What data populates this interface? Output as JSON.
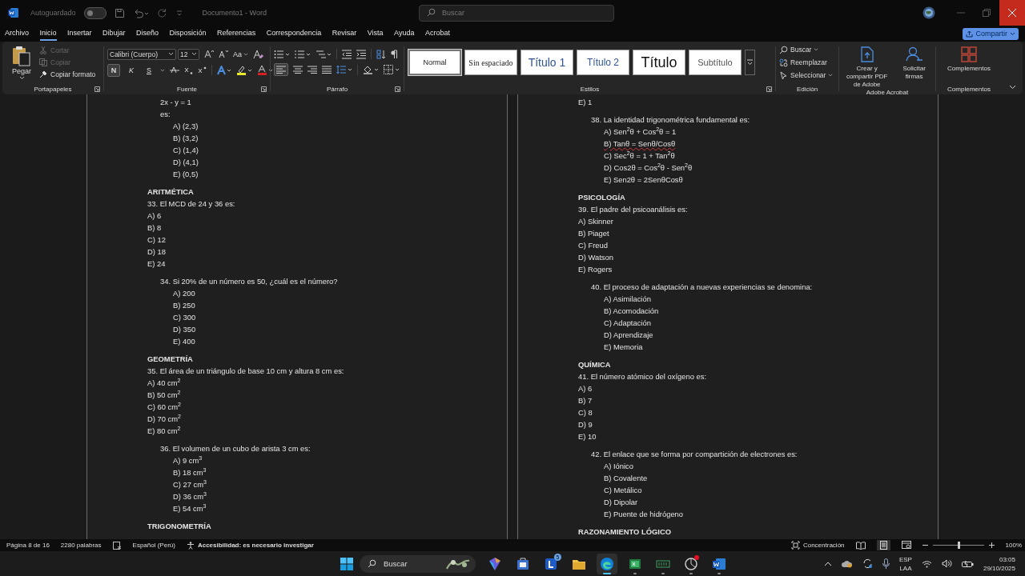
{
  "title_bar": {
    "autosave_label": "Autoguardado",
    "autosave_on": false,
    "document_title": "Documento1 - Word",
    "search_placeholder": "Buscar"
  },
  "menu_tabs": [
    {
      "label": "Archivo",
      "selected": false
    },
    {
      "label": "Inicio",
      "selected": true
    },
    {
      "label": "Insertar",
      "selected": false
    },
    {
      "label": "Dibujar",
      "selected": false
    },
    {
      "label": "Diseño",
      "selected": false
    },
    {
      "label": "Disposición",
      "selected": false
    },
    {
      "label": "Referencias",
      "selected": false
    },
    {
      "label": "Correspondencia",
      "selected": false
    },
    {
      "label": "Revisar",
      "selected": false
    },
    {
      "label": "Vista",
      "selected": false
    },
    {
      "label": "Ayuda",
      "selected": false
    },
    {
      "label": "Acrobat",
      "selected": false
    }
  ],
  "share_button": "Compartir",
  "ribbon": {
    "clipboard": {
      "label": "Portapapeles",
      "paste": "Pegar",
      "actions": [
        {
          "label": "Cortar",
          "disabled": true
        },
        {
          "label": "Copiar",
          "disabled": true
        },
        {
          "label": "Copiar formato",
          "disabled": false
        }
      ]
    },
    "font": {
      "label": "Fuente",
      "font_name": "Calibri (Cuerpo)",
      "font_size": "12",
      "case_button": "Aa",
      "format_buttons": [
        {
          "label": "N",
          "selected": true
        },
        {
          "label": "K",
          "selected": false
        },
        {
          "label": "S",
          "selected": false
        }
      ]
    },
    "paragraph": {
      "label": "Párrafo"
    },
    "styles": {
      "label": "Estilos",
      "items": [
        {
          "label": "Normal",
          "kind": "normal",
          "selected": true
        },
        {
          "label": "Sin espaciado",
          "kind": "nospacing",
          "selected": false
        },
        {
          "label": "Título 1",
          "kind": "heading1",
          "selected": false
        },
        {
          "label": "Título 2",
          "kind": "heading2",
          "selected": false
        },
        {
          "label": "Título",
          "kind": "title",
          "selected": false
        },
        {
          "label": "Subtítulo",
          "kind": "subtitle",
          "selected": false
        }
      ]
    },
    "editing": {
      "label": "Edición",
      "actions": [
        "Buscar",
        "Reemplazar",
        "Seleccionar"
      ]
    },
    "acrobat": {
      "label": "Adobe Acrobat",
      "actions": [
        "Crear y compartir PDF de Adobe",
        "Solicitar firmas"
      ]
    },
    "addins": {
      "label": "Complementos",
      "button": "Complementos"
    }
  },
  "document": {
    "pages": [
      {
        "blocks": [
          {
            "kind": "question",
            "indented": true,
            "lines": [
              "2x - y = 1",
              "es:"
            ],
            "options": [
              "A) (2,3)",
              "B) (3,2)",
              "C) (1,4)",
              "D) (4,1)",
              "E) (0,5)"
            ]
          },
          {
            "kind": "heading",
            "text": "ARITMÉTICA"
          },
          {
            "kind": "question",
            "indented": false,
            "lines": [
              "33. El MCD de 24 y 36 es:"
            ],
            "options": [
              "A) 6",
              "B) 8",
              "C) 12",
              "D) 18",
              "E) 24"
            ]
          },
          {
            "kind": "question",
            "indented": true,
            "lines": [
              "34. Si 20% de un número es 50, ¿cuál es el número?"
            ],
            "options": [
              "A) 200",
              "B) 250",
              "C) 300",
              "D) 350",
              "E) 400"
            ]
          },
          {
            "kind": "heading",
            "text": "GEOMETRÍA"
          },
          {
            "kind": "question",
            "indented": false,
            "lines": [
              "35. El área de un triángulo de base 10 cm y altura 8 cm es:"
            ],
            "options": [
              "A) 40 cm$^{2}$",
              "B) 50 cm$^{2}$",
              "C) 60 cm$^{2}$",
              "D) 70 cm$^{2}$",
              "E) 80 cm$^{2}$"
            ]
          },
          {
            "kind": "question",
            "indented": true,
            "lines": [
              "36. El volumen de un cubo de arista 3 cm es:"
            ],
            "options": [
              "A) 9 cm$^{3}$",
              "B) 18 cm$^{3}$",
              "C) 27 cm$^{3}$",
              "D) 36 cm$^{3}$",
              "E) 54 cm$^{3}$"
            ]
          },
          {
            "kind": "heading",
            "text": "TRIGONOMETRÍA"
          }
        ]
      },
      {
        "blocks": [
          {
            "kind": "question",
            "indented": false,
            "options": [
              "E) 1"
            ]
          },
          {
            "kind": "question",
            "indented": true,
            "lines": [
              "38. La identidad trigonométrica fundamental es:"
            ],
            "options": [
              "A) Sen$^{2}$θ + Cos$^{2}$θ = 1",
              {
                "text": "B) Tanθ = Senθ/Cosθ",
                "misspelled": true
              },
              "C) Sec$^{2}$θ = 1 + Tan$^{2}$θ",
              "D) Cos2θ = Cos$^{2}$θ - Sen$^{2}$θ",
              "E) Sen2θ = 2SenθCosθ"
            ]
          },
          {
            "kind": "heading",
            "text": "PSICOLOGÍA"
          },
          {
            "kind": "question",
            "indented": false,
            "lines": [
              "39. El padre del psicoanálisis es:"
            ],
            "options": [
              "A) Skinner",
              "B) Piaget",
              "C) Freud",
              "D) Watson",
              "E) Rogers"
            ]
          },
          {
            "kind": "question",
            "indented": true,
            "lines": [
              "40. El proceso de adaptación a nuevas experiencias se denomina:"
            ],
            "options": [
              "A) Asimilación",
              "B) Acomodación",
              "C) Adaptación",
              "D) Aprendizaje",
              "E) Memoria"
            ]
          },
          {
            "kind": "heading",
            "text": "QUÍMICA"
          },
          {
            "kind": "question",
            "indented": false,
            "lines": [
              "41. El número atómico del oxígeno es:"
            ],
            "options": [
              "A) 6",
              "B) 7",
              "C) 8",
              "D) 9",
              "E) 10"
            ]
          },
          {
            "kind": "question",
            "indented": true,
            "lines": [
              "42. El enlace que se forma por compartición de electrones es:"
            ],
            "options": [
              "A) Iónico",
              "B) Covalente",
              "C) Metálico",
              "D) Dipolar",
              "E) Puente de hidrógeno"
            ]
          },
          {
            "kind": "heading",
            "text": "RAZONAMIENTO LÓGICO"
          }
        ]
      }
    ]
  },
  "status_bar": {
    "page": "Página 8 de 16",
    "words": "2280 palabras",
    "language": "Español (Perú)",
    "accessibility": "Accesibilidad: es necesario investigar",
    "focus": "Concentración",
    "zoom": "100%",
    "zoom_level": {
      "level": 0.5
    }
  },
  "taskbar": {
    "search_placeholder": "Buscar",
    "apps": [
      {
        "running": false,
        "selected": false
      },
      {
        "running": false,
        "selected": false
      },
      {
        "running": false,
        "selected": false,
        "badge": "5"
      },
      {
        "running": false,
        "selected": false
      },
      {
        "running": true,
        "selected": true
      },
      {
        "running": true,
        "selected": false
      },
      {
        "running": true,
        "selected": false
      },
      {
        "running": true,
        "selected": false,
        "alert": true
      },
      {
        "running": true,
        "selected": false
      }
    ],
    "language": "ESP",
    "layout": "LAA",
    "time": "03:05",
    "date": "29/10/2025"
  }
}
